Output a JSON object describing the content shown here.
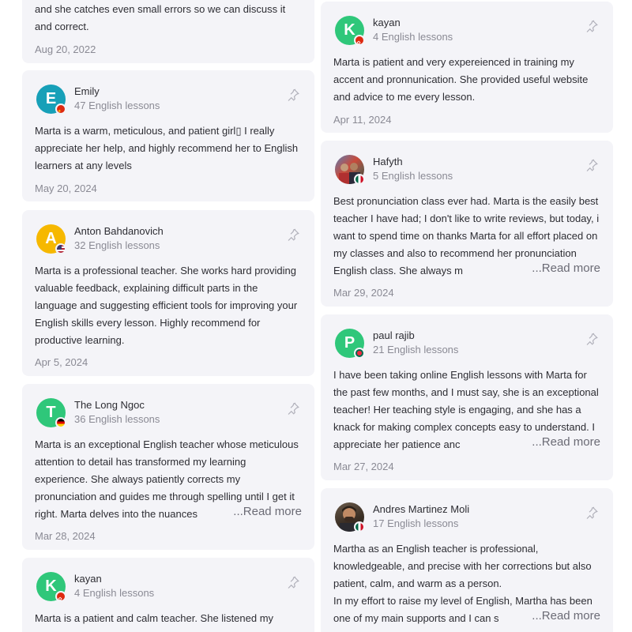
{
  "read_more_label": "...Read more",
  "left": {
    "card0": {
      "text": "and she catches even small errors so we can discuss it and correct.",
      "date": "Aug 20, 2022"
    },
    "card1": {
      "name": "Emily",
      "initial": "E",
      "avatar_color": "#17a0b8",
      "flag": "flag-china-icon",
      "lessons": "47 English lessons",
      "text": "Marta is a warm, meticulous, and patient girl▯ I really appreciate her help, and highly recommend her to English learners at any levels",
      "date": "May 20, 2024"
    },
    "card2": {
      "name": "Anton Bahdanovich",
      "initial": "A",
      "avatar_color": "#f6b800",
      "flag": "flag-usa-icon",
      "lessons": "32 English lessons",
      "text": "Marta is a professional teacher.  She works hard providing valuable feedback, explaining difficult parts in the language and suggesting efficient tools for improving your English skills  every lesson. Highly recommend for productive learning.",
      "date": "Apr 5, 2024"
    },
    "card3": {
      "name": "The Long Ngoc",
      "initial": "T",
      "avatar_color": "#2fc77a",
      "flag": "flag-germany-icon",
      "lessons": "36 English lessons",
      "text": "Marta is an exceptional English teacher whose meticulous attention to detail has transformed my learning experience. She always patiently corrects my pronunciation and guides me through spelling until I get it right. Marta delves into the nuances",
      "date": "Mar 28, 2024"
    },
    "card4": {
      "name": "kayan",
      "initial": "K",
      "avatar_color": "#2fc77a",
      "flag": "flag-hongkong-icon",
      "lessons": "4 English lessons",
      "text": "Marta is a patient and calm teacher.  She listened my"
    }
  },
  "right": {
    "card0": {
      "name": "kayan",
      "initial": "K",
      "avatar_color": "#2fc77a",
      "flag": "flag-hongkong-icon",
      "lessons": "4 English lessons",
      "text": "Marta is patient and very expereienced in training my accent and pronnunication.  She provided useful website and advice to me every lesson.",
      "date": "Apr 11, 2024"
    },
    "card1": {
      "name": "Hafyth",
      "avatar_color": "#8a6a5a",
      "flag": "flag-mexico-icon",
      "lessons": "5 English lessons",
      "text": "Best pronunciation class ever had.  Marta is the easily best teacher I have had; I don't like to write reviews, but today, i want to spend time on thanks Marta for all effort placed on my classes and also to recommend her pronunciation English class. She always m",
      "date": "Mar 29, 2024"
    },
    "card2": {
      "name": "paul rajib",
      "initial": "P",
      "avatar_color": "#2fc77a",
      "flag": "flag-bangladesh-icon",
      "lessons": "21 English lessons",
      "text": "I have been taking online English lessons with Marta for the past few months, and I must say, she is an exceptional teacher! Her teaching style is engaging, and she has a knack for making complex concepts easy to understand. I appreciate her patience anc",
      "date": "Mar 27, 2024"
    },
    "card3": {
      "name": "Andres Martinez Moli",
      "avatar_color": "#5a4a3a",
      "flag": "flag-mexico-icon",
      "lessons": "17 English lessons",
      "text": "Martha as an English teacher is professional, knowledgeable, and precise with her corrections but also patient, calm, and warm as a person.\nIn my effort to raise my level of English, Martha has been one of my main supports and I can s"
    }
  }
}
